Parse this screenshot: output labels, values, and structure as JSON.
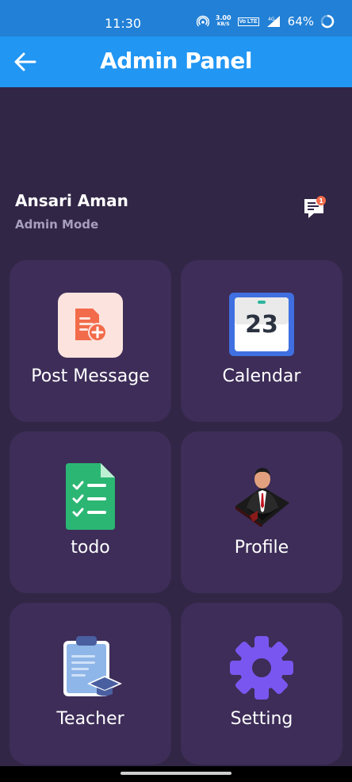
{
  "status_bar": {
    "time": "11:30",
    "net_speed_value": "3.00",
    "net_speed_unit": "KB/S",
    "volte_label": "Vo LTE",
    "network_type": "4G",
    "battery": "64%"
  },
  "app_bar": {
    "title": "Admin Panel",
    "back_icon": "arrow-left-icon"
  },
  "user": {
    "name": "Ansari Aman",
    "mode": "Admin Mode",
    "chat_badge_count": "1"
  },
  "cards": [
    {
      "label": "Post Message",
      "icon": "post-message-icon"
    },
    {
      "label": "Calendar",
      "icon": "calendar-icon",
      "calendar_day": "23"
    },
    {
      "label": "todo",
      "icon": "todo-icon"
    },
    {
      "label": "Profile",
      "icon": "profile-icon"
    },
    {
      "label": "Teacher",
      "icon": "teacher-icon"
    },
    {
      "label": "Setting",
      "icon": "gear-icon"
    }
  ],
  "colors": {
    "status_bar": "#2280d6",
    "app_bar": "#2196f3",
    "background": "#322646",
    "card": "#3d2d58",
    "subtitle": "#a79ebf",
    "badge": "#f26b4a"
  }
}
